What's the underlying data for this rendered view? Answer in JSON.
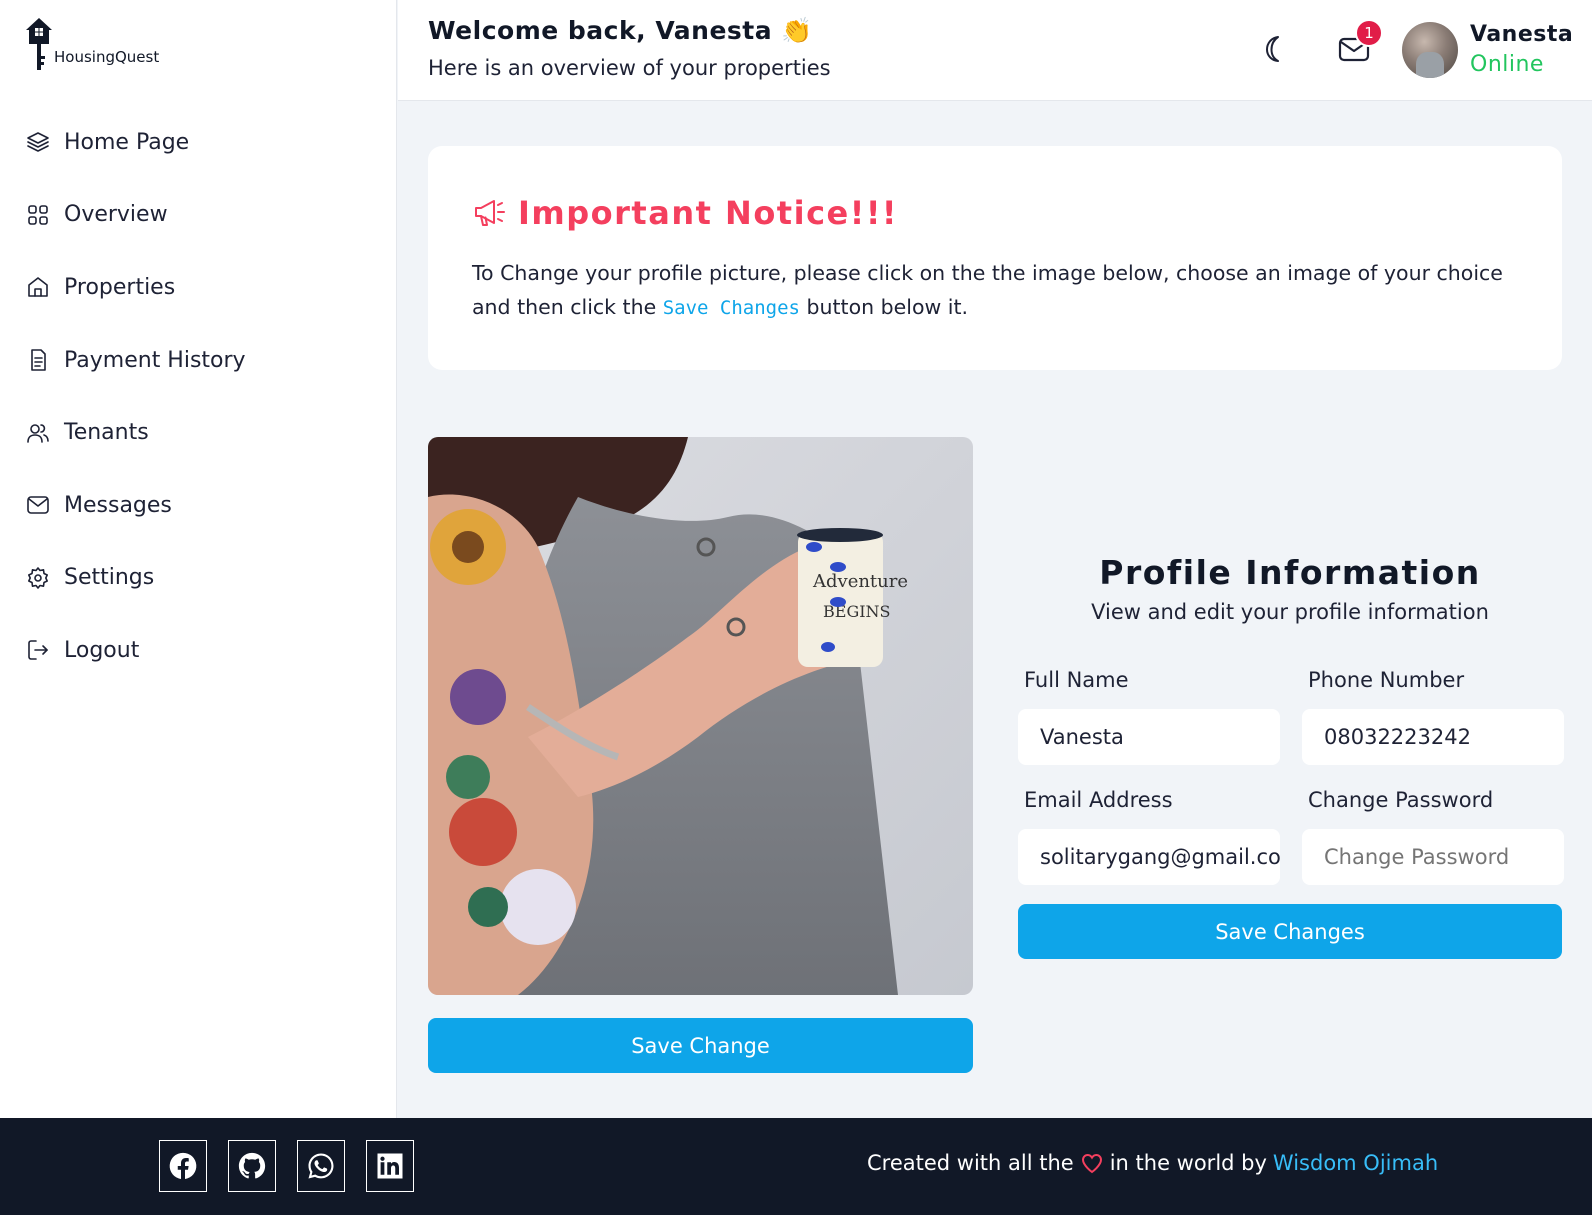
{
  "app": {
    "name": "HousingQuest"
  },
  "sidebar": {
    "items": [
      {
        "label": "Home Page",
        "icon": "layers-icon"
      },
      {
        "label": "Overview",
        "icon": "grid-icon"
      },
      {
        "label": "Properties",
        "icon": "home-icon"
      },
      {
        "label": "Payment History",
        "icon": "document-icon"
      },
      {
        "label": "Tenants",
        "icon": "users-icon"
      },
      {
        "label": "Messages",
        "icon": "mail-icon"
      },
      {
        "label": "Settings",
        "icon": "gear-icon"
      },
      {
        "label": "Logout",
        "icon": "logout-icon"
      }
    ]
  },
  "header": {
    "welcome": "Welcome back, Vanesta 👏",
    "subtitle": "Here is an overview of your properties",
    "notification_count": "1",
    "user_name": "Vanesta",
    "user_status": "Online",
    "status_color": "#22c55e"
  },
  "notice": {
    "title": "Important Notice!!!",
    "text_before": "To Change your profile picture, please click on the the image below, choose an image of your choice and then click the ",
    "code": "Save Changes",
    "text_after": " button below it.",
    "accent_color": "#f43f5e"
  },
  "photo": {
    "button_label": "Save Change"
  },
  "profile": {
    "title": "Profile Information",
    "subtitle": "View and edit your profile information",
    "full_name_label": "Full Name",
    "full_name_value": "Vanesta",
    "phone_label": "Phone Number",
    "phone_value": "08032223242",
    "email_label": "Email Address",
    "email_value": "solitarygang@gmail.com",
    "password_label": "Change Password",
    "password_placeholder": "Change Password",
    "save_label": "Save Changes",
    "button_color": "#0ea5e9"
  },
  "footer": {
    "socials": [
      "facebook-icon",
      "github-icon",
      "whatsapp-icon",
      "linkedin-icon"
    ],
    "credit_before": "Created with all the",
    "credit_after": "in the world by",
    "author": "Wisdom Ojimah"
  }
}
